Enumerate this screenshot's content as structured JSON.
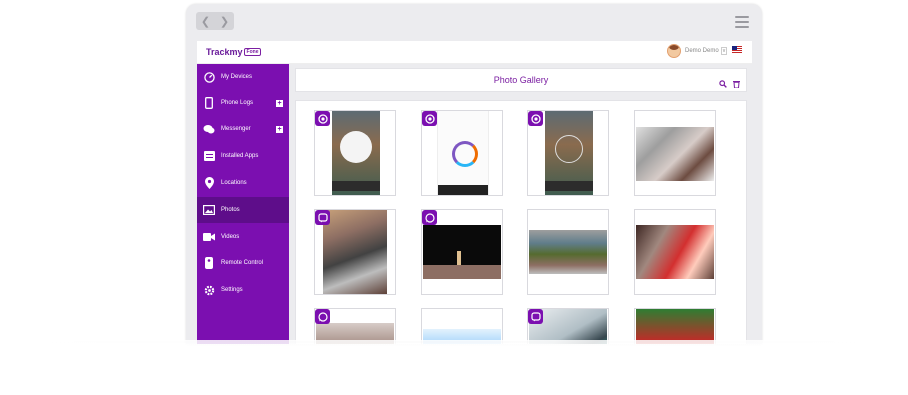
{
  "header": {
    "logo_text": "Trackmy",
    "logo_box_text": "Fone",
    "user_name": "Demo Demo",
    "user_caret": "v"
  },
  "browser": {
    "back_icon": "chevron-left-icon",
    "forward_icon": "chevron-right-icon",
    "menu_icon": "hamburger-icon"
  },
  "sidebar": {
    "items": [
      {
        "label": "My Devices",
        "icon": "gauge-icon"
      },
      {
        "label": "Phone Logs",
        "icon": "phone-icon",
        "expand": "+"
      },
      {
        "label": "Messenger",
        "icon": "chat-icon",
        "expand": "+"
      },
      {
        "label": "Installed Apps",
        "icon": "apps-icon"
      },
      {
        "label": "Locations",
        "icon": "pin-icon"
      },
      {
        "label": "Photos",
        "icon": "image-icon",
        "active": true
      },
      {
        "label": "Videos",
        "icon": "video-icon"
      },
      {
        "label": "Remote Control",
        "icon": "remote-icon"
      },
      {
        "label": "Settings",
        "icon": "gear-icon"
      }
    ]
  },
  "gallery": {
    "title": "Photo Gallery",
    "search_icon": "search-icon",
    "delete_icon": "trash-icon",
    "photos": [
      {
        "badge": "camera-shutter",
        "subject": "phone-screenshot-home"
      },
      {
        "badge": "camera-shutter",
        "subject": "phone-screenshot-setup"
      },
      {
        "badge": "camera-shutter",
        "subject": "phone-screenshot-home"
      },
      {
        "badge": "",
        "subject": "office-photo"
      },
      {
        "badge": "viber",
        "subject": "classroom-photo"
      },
      {
        "badge": "whatsapp",
        "subject": "stage-photo"
      },
      {
        "badge": "",
        "subject": "classroom-photo"
      },
      {
        "badge": "",
        "subject": "party-photo"
      },
      {
        "badge": "whatsapp",
        "subject": "mall-photo"
      },
      {
        "badge": "",
        "subject": "beach-photo"
      },
      {
        "badge": "viber",
        "subject": "tablet-photo"
      },
      {
        "badge": "",
        "subject": "christmas-photo"
      }
    ]
  },
  "colors": {
    "brand": "#7b0fb0",
    "brand_dark": "#5e0d8a",
    "title": "#7b1fa2"
  }
}
